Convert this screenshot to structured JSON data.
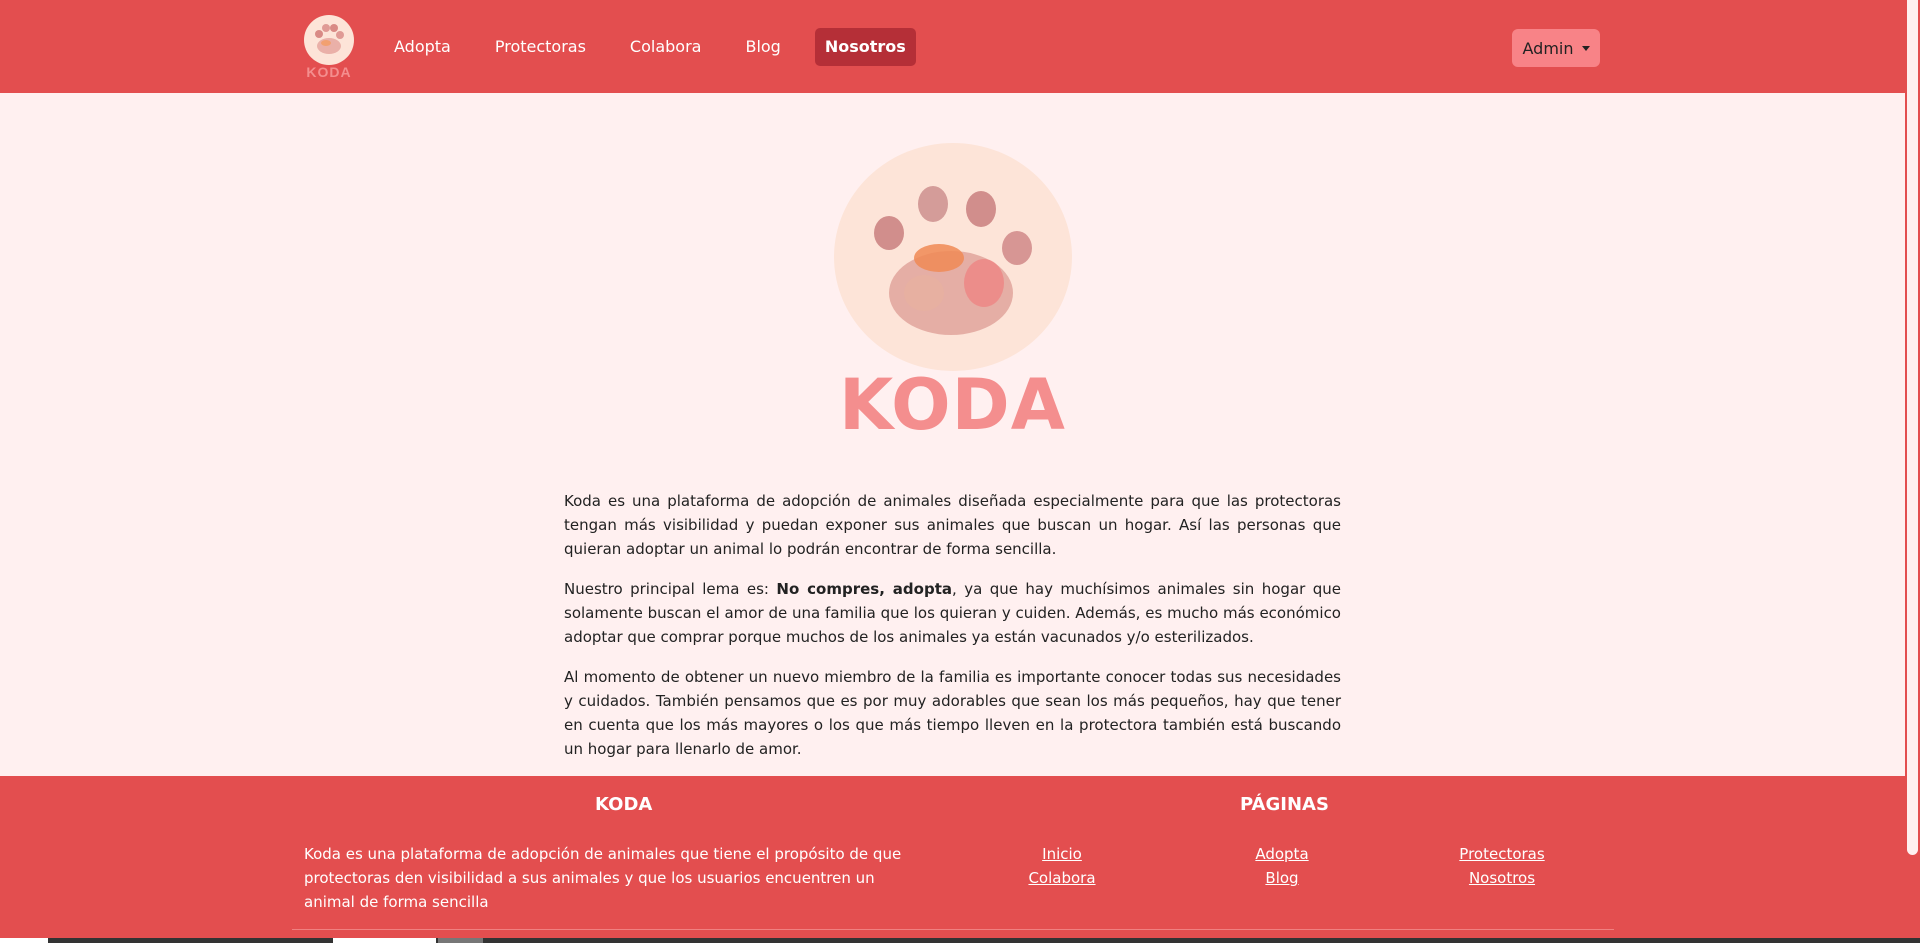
{
  "brand": {
    "name": "KODA"
  },
  "nav": {
    "links": [
      {
        "label": "Adopta"
      },
      {
        "label": "Protectoras"
      },
      {
        "label": "Colabora"
      },
      {
        "label": "Blog"
      },
      {
        "label": "Nosotros",
        "active": true
      }
    ],
    "admin_label": "Admin"
  },
  "hero": {
    "title": "KODA",
    "icon": "paw-icon"
  },
  "content": {
    "p1": "Koda es una plataforma de adopción de animales diseñada especialmente para que las protectoras tengan más visibilidad y puedan exponer sus animales que buscan un hogar. Así las personas que quieran adoptar un animal lo podrán encontrar de forma sencilla.",
    "p2_prefix": "Nuestro principal lema es: ",
    "p2_bold": "No compres, adopta",
    "p2_suffix": ", ya que hay muchísimos animales sin hogar que solamente buscan el amor de una familia que los quieran y cuiden. Además, es mucho más económico adoptar que comprar porque muchos de los animales ya están vacunados y/o esterilizados.",
    "p3": "Al momento de obtener un nuevo miembro de la familia es importante conocer todas sus necesidades y cuidados. También pensamos que es por muy adorables que sean los más pequeños, hay que tener en cuenta que los más mayores o los que más tiempo lleven en la protectora también está buscando un hogar para llenarlo de amor."
  },
  "footer": {
    "about_title": "KODA",
    "about_text": "Koda es una plataforma de adopción de animales que tiene el propósito de que protectoras den visibilidad a sus animales y que los usuarios encuentren un animal de forma sencilla",
    "pages_title": "PÁGINAS",
    "links": [
      "Inicio",
      "Colabora",
      "Adopta",
      "Blog",
      "Protectoras",
      "Nosotros"
    ]
  },
  "colors": {
    "primary": "#e34e4f",
    "active_nav": "#b52f37",
    "admin_button": "#f88387",
    "background": "#fff0f0",
    "logo_circle": "#fde4d8",
    "brand_text": "#f48e8e"
  }
}
